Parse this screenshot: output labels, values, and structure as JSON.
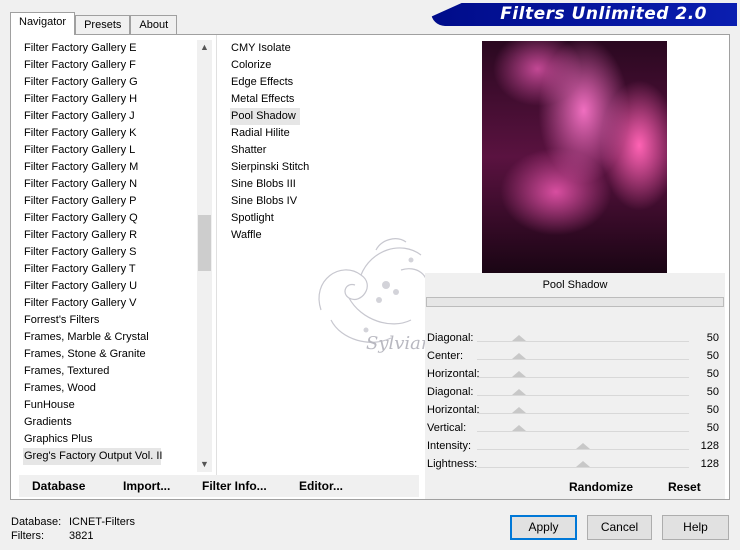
{
  "tabs": [
    {
      "label": "Navigator",
      "active": true
    },
    {
      "label": "Presets",
      "active": false
    },
    {
      "label": "About",
      "active": false
    }
  ],
  "banner": {
    "title": "Filters Unlimited 2.0"
  },
  "categories": [
    "Filter Factory Gallery E",
    "Filter Factory Gallery F",
    "Filter Factory Gallery G",
    "Filter Factory Gallery H",
    "Filter Factory Gallery J",
    "Filter Factory Gallery K",
    "Filter Factory Gallery L",
    "Filter Factory Gallery M",
    "Filter Factory Gallery N",
    "Filter Factory Gallery P",
    "Filter Factory Gallery Q",
    "Filter Factory Gallery R",
    "Filter Factory Gallery S",
    "Filter Factory Gallery T",
    "Filter Factory Gallery U",
    "Filter Factory Gallery V",
    "Forrest's Filters",
    "Frames, Marble & Crystal",
    "Frames, Stone & Granite",
    "Frames, Textured",
    "Frames, Wood",
    "FunHouse",
    "Gradients",
    "Graphics Plus",
    "Greg's Factory Output Vol. II"
  ],
  "selected_category": "Greg's Factory Output Vol. II",
  "filters": [
    "CMY Isolate",
    "Colorize",
    "Edge Effects",
    "Metal Effects",
    "Pool Shadow",
    "Radial Hilite",
    "Shatter",
    "Sierpinski Stitch",
    "Sine Blobs III",
    "Sine Blobs IV",
    "Spotlight",
    "Waffle"
  ],
  "selected_filter": "Pool Shadow",
  "filter_name": "Pool Shadow",
  "params": [
    {
      "label": "Diagonal:",
      "value": 50
    },
    {
      "label": "Center:",
      "value": 50
    },
    {
      "label": "Horizontal:",
      "value": 50
    },
    {
      "label": "Diagonal:",
      "value": 50
    },
    {
      "label": "Horizontal:",
      "value": 50
    },
    {
      "label": "Vertical:",
      "value": 50
    },
    {
      "label": "Intensity:",
      "value": 128
    },
    {
      "label": "Lightness:",
      "value": 128
    }
  ],
  "param_max": 255,
  "toolbar": {
    "database": "Database",
    "import": "Import...",
    "filter_info": "Filter Info...",
    "editor": "Editor...",
    "randomize": "Randomize",
    "reset": "Reset"
  },
  "watermark": "Sylviane",
  "status": {
    "database_label": "Database:",
    "database_value": "ICNET-Filters",
    "filters_label": "Filters:",
    "filters_value": "3821"
  },
  "buttons": {
    "apply": "Apply",
    "cancel": "Cancel",
    "help": "Help"
  },
  "colors": {
    "banner": "#000c8a",
    "preview_pink": "#f06fc0"
  }
}
